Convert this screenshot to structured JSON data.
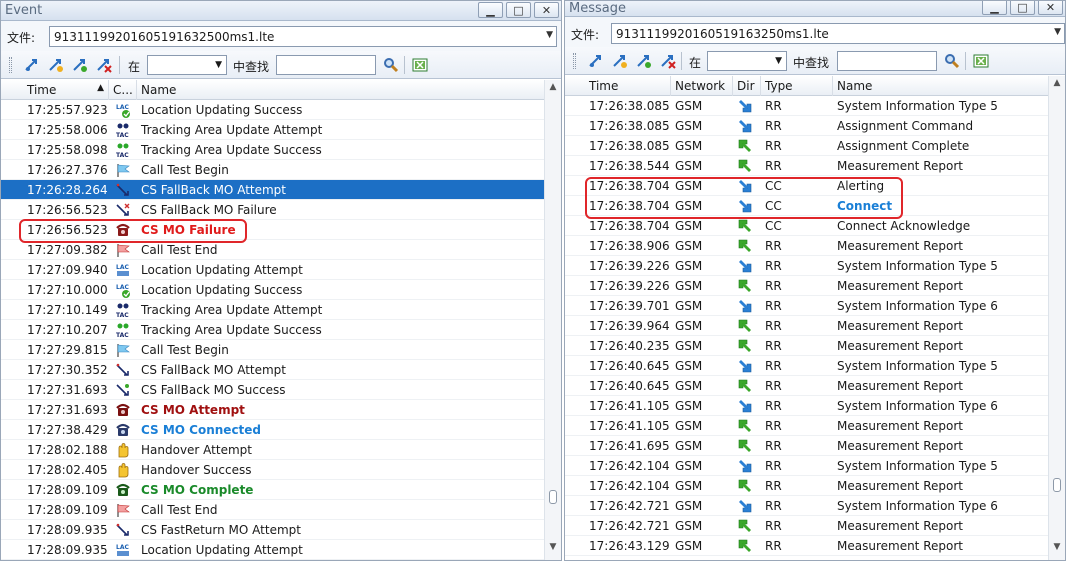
{
  "event_panel": {
    "title": "Event",
    "file_label": "文件:",
    "file_value": "91311199201605191632500ms1.lte",
    "in_label": "在",
    "find_label": "中查找",
    "columns": [
      "Time",
      "C...",
      "Name"
    ],
    "rows": [
      {
        "time": "17:25:57.923",
        "icon": "lac-check-icon",
        "name": "Location Updating Success",
        "style": "normal"
      },
      {
        "time": "17:25:58.006",
        "icon": "tac-dots-icon",
        "name": "Tracking Area Update Attempt",
        "style": "normal"
      },
      {
        "time": "17:25:58.098",
        "icon": "tac-dots-green-icon",
        "name": "Tracking Area Update Success",
        "style": "normal"
      },
      {
        "time": "17:26:27.376",
        "icon": "flag-blue-icon",
        "name": "Call Test Begin",
        "style": "normal"
      },
      {
        "time": "17:26:28.264",
        "icon": "fallback-arrow-icon",
        "name": "CS FallBack MO Attempt",
        "style": "selected"
      },
      {
        "time": "17:26:56.523",
        "icon": "fallback-fail-icon",
        "name": "CS FallBack MO Failure",
        "style": "normal"
      },
      {
        "time": "17:26:56.523",
        "icon": "phone-red-icon",
        "name": "CS MO Failure",
        "style": "red"
      },
      {
        "time": "17:27:09.382",
        "icon": "flag-red-icon",
        "name": "Call Test End",
        "style": "normal"
      },
      {
        "time": "17:27:09.940",
        "icon": "lac-icon",
        "name": "Location Updating Attempt",
        "style": "normal"
      },
      {
        "time": "17:27:10.000",
        "icon": "lac-check-icon",
        "name": "Location Updating Success",
        "style": "normal"
      },
      {
        "time": "17:27:10.149",
        "icon": "tac-dots-icon",
        "name": "Tracking Area Update Attempt",
        "style": "normal"
      },
      {
        "time": "17:27:10.207",
        "icon": "tac-dots-green-icon",
        "name": "Tracking Area Update Success",
        "style": "normal"
      },
      {
        "time": "17:27:29.815",
        "icon": "flag-blue-icon",
        "name": "Call Test Begin",
        "style": "normal"
      },
      {
        "time": "17:27:30.352",
        "icon": "fallback-arrow-icon",
        "name": "CS FallBack MO Attempt",
        "style": "normal"
      },
      {
        "time": "17:27:31.693",
        "icon": "fallback-ok-icon",
        "name": "CS FallBack MO Success",
        "style": "normal"
      },
      {
        "time": "17:27:31.693",
        "icon": "phone-darkred-icon",
        "name": "CS MO Attempt",
        "style": "darkred"
      },
      {
        "time": "17:27:38.429",
        "icon": "phone-blue-icon",
        "name": "CS MO Connected",
        "style": "blue"
      },
      {
        "time": "17:28:02.188",
        "icon": "hand-icon",
        "name": "Handover Attempt",
        "style": "normal"
      },
      {
        "time": "17:28:02.405",
        "icon": "hand-icon",
        "name": "Handover Success",
        "style": "normal"
      },
      {
        "time": "17:28:09.109",
        "icon": "phone-green-icon",
        "name": "CS MO Complete",
        "style": "green"
      },
      {
        "time": "17:28:09.109",
        "icon": "flag-red-icon",
        "name": "Call Test End",
        "style": "normal"
      },
      {
        "time": "17:28:09.935",
        "icon": "fallback-arrow-icon",
        "name": "CS FastReturn MO Attempt",
        "style": "normal"
      },
      {
        "time": "17:28:09.935",
        "icon": "lac-icon",
        "name": "Location Updating Attempt",
        "style": "normal"
      }
    ]
  },
  "message_panel": {
    "title": "Message",
    "file_label": "文件:",
    "file_value": "9131119920160519163250ms1.lte",
    "in_label": "在",
    "find_label": "中查找",
    "columns": [
      "Time",
      "Network",
      "Dir",
      "Type",
      "Name"
    ],
    "rows": [
      {
        "time": "17:26:38.085",
        "network": "GSM",
        "dir": "down",
        "type": "RR",
        "name": "System Information Type 5",
        "style": "normal"
      },
      {
        "time": "17:26:38.085",
        "network": "GSM",
        "dir": "down",
        "type": "RR",
        "name": "Assignment Command",
        "style": "normal"
      },
      {
        "time": "17:26:38.085",
        "network": "GSM",
        "dir": "up",
        "type": "RR",
        "name": "Assignment Complete",
        "style": "normal"
      },
      {
        "time": "17:26:38.544",
        "network": "GSM",
        "dir": "up",
        "type": "RR",
        "name": "Measurement Report",
        "style": "normal"
      },
      {
        "time": "17:26:38.704",
        "network": "GSM",
        "dir": "down",
        "type": "CC",
        "name": "Alerting",
        "style": "normal"
      },
      {
        "time": "17:26:38.704",
        "network": "GSM",
        "dir": "down",
        "type": "CC",
        "name": "Connect",
        "style": "blue"
      },
      {
        "time": "17:26:38.704",
        "network": "GSM",
        "dir": "up",
        "type": "CC",
        "name": "Connect Acknowledge",
        "style": "normal"
      },
      {
        "time": "17:26:38.906",
        "network": "GSM",
        "dir": "up",
        "type": "RR",
        "name": "Measurement Report",
        "style": "normal"
      },
      {
        "time": "17:26:39.226",
        "network": "GSM",
        "dir": "down",
        "type": "RR",
        "name": "System Information Type 5",
        "style": "normal"
      },
      {
        "time": "17:26:39.226",
        "network": "GSM",
        "dir": "up",
        "type": "RR",
        "name": "Measurement Report",
        "style": "normal"
      },
      {
        "time": "17:26:39.701",
        "network": "GSM",
        "dir": "down",
        "type": "RR",
        "name": "System Information Type 6",
        "style": "normal"
      },
      {
        "time": "17:26:39.964",
        "network": "GSM",
        "dir": "up",
        "type": "RR",
        "name": "Measurement Report",
        "style": "normal"
      },
      {
        "time": "17:26:40.235",
        "network": "GSM",
        "dir": "up",
        "type": "RR",
        "name": "Measurement Report",
        "style": "normal"
      },
      {
        "time": "17:26:40.645",
        "network": "GSM",
        "dir": "down",
        "type": "RR",
        "name": "System Information Type 5",
        "style": "normal"
      },
      {
        "time": "17:26:40.645",
        "network": "GSM",
        "dir": "up",
        "type": "RR",
        "name": "Measurement Report",
        "style": "normal"
      },
      {
        "time": "17:26:41.105",
        "network": "GSM",
        "dir": "down",
        "type": "RR",
        "name": "System Information Type 6",
        "style": "normal"
      },
      {
        "time": "17:26:41.105",
        "network": "GSM",
        "dir": "up",
        "type": "RR",
        "name": "Measurement Report",
        "style": "normal"
      },
      {
        "time": "17:26:41.695",
        "network": "GSM",
        "dir": "up",
        "type": "RR",
        "name": "Measurement Report",
        "style": "normal"
      },
      {
        "time": "17:26:42.104",
        "network": "GSM",
        "dir": "down",
        "type": "RR",
        "name": "System Information Type 5",
        "style": "normal"
      },
      {
        "time": "17:26:42.104",
        "network": "GSM",
        "dir": "up",
        "type": "RR",
        "name": "Measurement Report",
        "style": "normal"
      },
      {
        "time": "17:26:42.721",
        "network": "GSM",
        "dir": "down",
        "type": "RR",
        "name": "System Information Type 6",
        "style": "normal"
      },
      {
        "time": "17:26:42.721",
        "network": "GSM",
        "dir": "up",
        "type": "RR",
        "name": "Measurement Report",
        "style": "normal"
      },
      {
        "time": "17:26:43.129",
        "network": "GSM",
        "dir": "up",
        "type": "RR",
        "name": "Measurement Report",
        "style": "normal"
      }
    ]
  },
  "colors": {
    "selected_bg": "#1c6fc5",
    "highlight_red": "#e0262a",
    "text_red": "#e01b1b",
    "text_darkred": "#a01010",
    "text_blue": "#1a7fd6",
    "text_green": "#1a8a2a",
    "arrow_down_blue": "#2a7fd4",
    "arrow_up_green": "#3aa82a"
  }
}
